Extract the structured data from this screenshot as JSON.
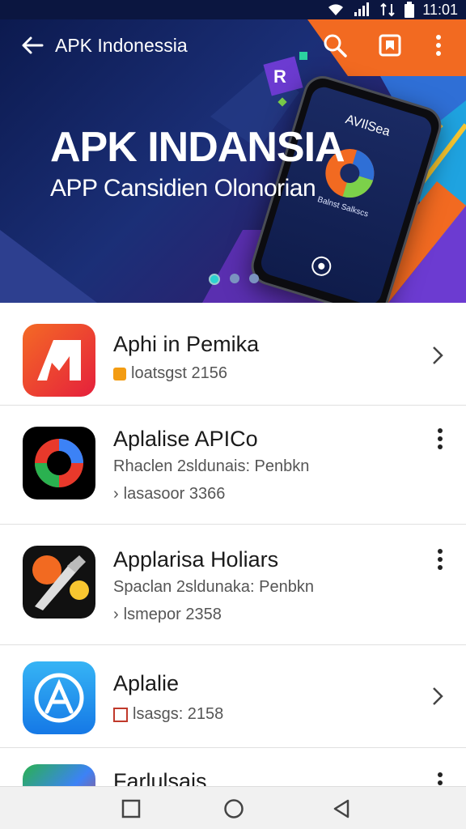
{
  "status_bar": {
    "time": "11:01",
    "icons": [
      "wifi-icon",
      "signal-icon",
      "data-icon",
      "battery-icon"
    ]
  },
  "header": {
    "title": "APK Indonessia",
    "icons": [
      "back-arrow-icon",
      "search-icon",
      "bookmark-icon",
      "more-vert-icon"
    ]
  },
  "banner": {
    "title": "APK INDANSIA",
    "subtitle": "APP Cansidien Olonorian",
    "phone_title": "AVIlSea",
    "phone_text": "Balnst Salkscs",
    "dots": 3,
    "active_dot": 0
  },
  "apps": [
    {
      "name": "Aphi in Pemika",
      "line2": "",
      "meta": "loatsgst 2156",
      "action": "chevron"
    },
    {
      "name": "Aplalise APICo",
      "line2": "Rhaclen 2sldunais: Penbkn",
      "meta": "lasasoor 3366",
      "action": "more"
    },
    {
      "name": "Applarisa Holiars",
      "line2": "Spaclan 2sldunaka: Penbkn",
      "meta": "lsmepor 2358",
      "action": "more"
    },
    {
      "name": "Aplalie",
      "line2": "",
      "meta": "lsasgs: 2158",
      "action": "chevron"
    },
    {
      "name": "Farlulsais",
      "line2": "",
      "meta": "",
      "action": "more"
    }
  ],
  "nav": [
    "recents-button",
    "home-button",
    "back-button"
  ],
  "colors": {
    "accent": "#f26a21",
    "banner_dark": "#0c1a4f",
    "purple": "#6c3bd1"
  }
}
